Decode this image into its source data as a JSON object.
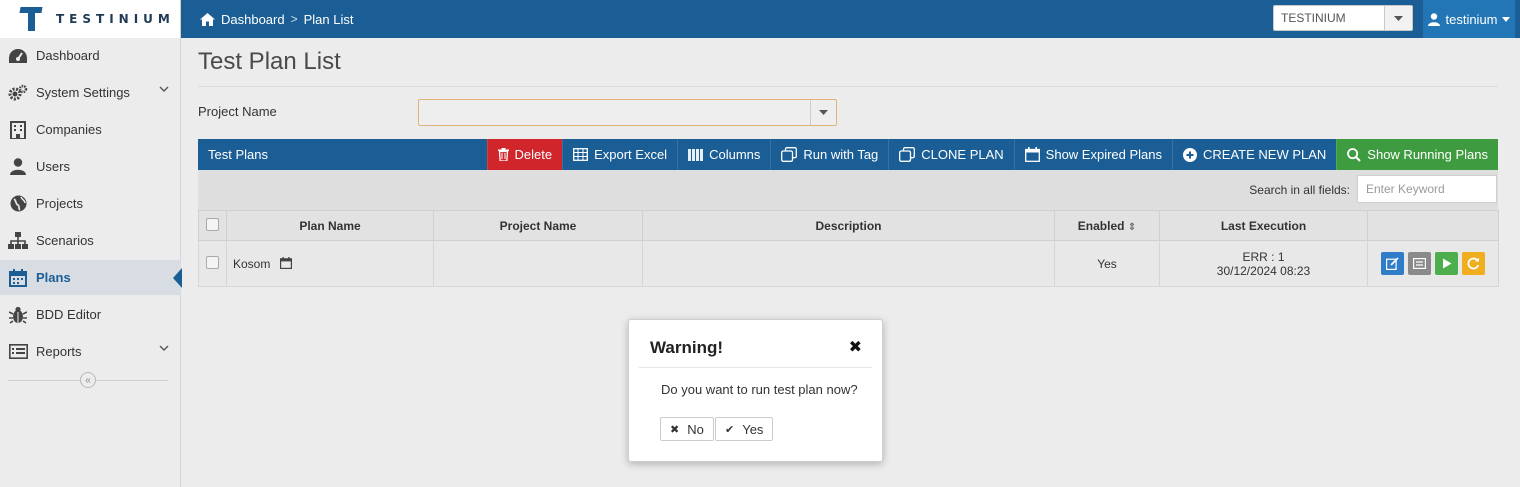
{
  "app": {
    "logo_text": "TESTINIUM"
  },
  "breadcrumb": {
    "home": "Dashboard",
    "separator": ">",
    "current": "Plan List"
  },
  "company_select": {
    "value": "TESTINIUM"
  },
  "user_menu": {
    "label": "testinium"
  },
  "sidebar": {
    "items": [
      {
        "label": "Dashboard",
        "icon": "dashboard-icon"
      },
      {
        "label": "System Settings",
        "icon": "gears-icon",
        "expandable": true
      },
      {
        "label": "Companies",
        "icon": "building-icon"
      },
      {
        "label": "Users",
        "icon": "user-icon"
      },
      {
        "label": "Projects",
        "icon": "globe-icon"
      },
      {
        "label": "Scenarios",
        "icon": "sitemap-icon"
      },
      {
        "label": "Plans",
        "icon": "calendar-icon",
        "active": true
      },
      {
        "label": "BDD Editor",
        "icon": "bug-icon"
      },
      {
        "label": "Reports",
        "icon": "list-icon",
        "expandable": true
      }
    ],
    "collapse_glyph": "«"
  },
  "page": {
    "title": "Test Plan List",
    "project_label": "Project Name",
    "project_value": ""
  },
  "toolbar": {
    "title": "Test Plans",
    "buttons": {
      "delete": "Delete",
      "export_excel": "Export Excel",
      "columns": "Columns",
      "run_with_tag": "Run with Tag",
      "clone_plan": "CLONE PLAN",
      "show_expired": "Show Expired Plans",
      "create_new": "CREATE NEW PLAN",
      "show_running": "Show Running Plans"
    }
  },
  "search": {
    "label": "Search in all fields:",
    "placeholder": "Enter Keyword"
  },
  "table": {
    "columns": [
      "Plan Name",
      "Project Name",
      "Description",
      "Enabled",
      "Last Execution"
    ],
    "sort_glyph": "⇕",
    "rows": [
      {
        "plan_name": "Kosom",
        "project_name": "",
        "description": "",
        "enabled": "Yes",
        "last_execution_status": "ERR : 1",
        "last_execution_time": "30/12/2024 08:23"
      }
    ]
  },
  "colors": {
    "primary": "#1a5e95",
    "danger": "#d0262b",
    "success": "#3e9b40",
    "edit": "#2f7dc8",
    "detail": "#8a8a8a",
    "run": "#4cae4c",
    "rerun": "#f0ad1e"
  },
  "modal": {
    "title": "Warning!",
    "close_glyph": "✖",
    "message": "Do you want to run test plan now?",
    "no_label": "No",
    "yes_label": "Yes",
    "no_glyph": "✖",
    "yes_glyph": "✔"
  }
}
